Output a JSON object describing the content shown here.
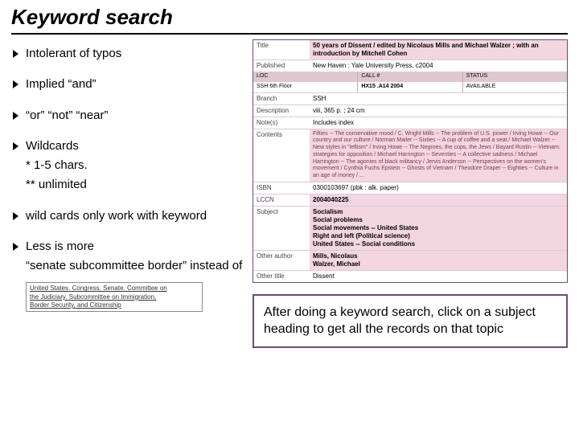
{
  "title": "Keyword search",
  "bullets": {
    "b1": "Intolerant of typos",
    "b2": "Implied “and”",
    "b3": "“or” “not” “near”",
    "b4": "Wildcards",
    "b4a": "* 1-5 chars.",
    "b4b": "** unlimited",
    "b5": "wild cards only work with keyword",
    "b6": "Less is more",
    "b6a": "“senate subcommittee border” instead of"
  },
  "committee": {
    "l1": "United States. Congress. Senate. Committee on",
    "l2": "the Judiciary. Subcommittee on Immigration,",
    "l3": "Border Security, and Citizenship"
  },
  "record": {
    "labels": {
      "title": "Title",
      "published": "Published",
      "branch": "Branch",
      "description": "Description",
      "note": "Note(s)",
      "contents": "Contents",
      "isbn": "ISBN",
      "lccn": "LCCN",
      "subject": "Subject",
      "otherauthor": "Other author",
      "othertitle": "Other title"
    },
    "title_val": "50 years of Dissent / edited by Nicolaus Mills and Michael Walzer ; with an introduction by Mitchell Cohen",
    "published_val": "New Haven : Yale University Press, c2004",
    "bar": {
      "loc": "LOC",
      "callno": "CALL #",
      "status": "STATUS",
      "loc_v": "SSH 6th Floor",
      "call_v": "HX15 .A14 2004",
      "status_v": "AVAILABLE"
    },
    "branch_val": "SSH",
    "desc_val": "viii, 365 p. ; 24 cm",
    "note_val": "Includes index",
    "contents_val": "Fifties -- The conservative mood / C. Wright Mills -- The problem of U.S. power / Irving Howe -- Our country and our culture / Norman Mailer -- Sixties -- A cup of coffee and a seat / Michael Walzer -- New styles in \"leftism\" / Irving Howe -- The Negroes, the cops, the Jews / Bayard Rustin -- Vietnam: strategies for opposition / Michael Harrington -- Seventies -- A collective sadness / Michael Harrington -- The agonies of black militancy / Jervis Anderson -- Perspectives on the women's movement / Cynthia Fuchs Epstein -- Ghosts of Vietnam / Theodore Draper -- Eighties -- Culture in an age of money / ...",
    "isbn_val": "0300103697 (pbk : alk. paper)",
    "lccn_val": "2004040225",
    "subjects": {
      "s1": "Socialism",
      "s2": "Social problems",
      "s3": "Social movements -- United States",
      "s4": "Right and left (Political science)",
      "s5": "United States -- Social conditions"
    },
    "authors": {
      "a1": "Mills, Nicolaus",
      "a2": "Walzer, Michael"
    },
    "othertitle_val": "Dissent"
  },
  "callout": "After doing a keyword search, click on a subject heading to get all the records on that topic"
}
